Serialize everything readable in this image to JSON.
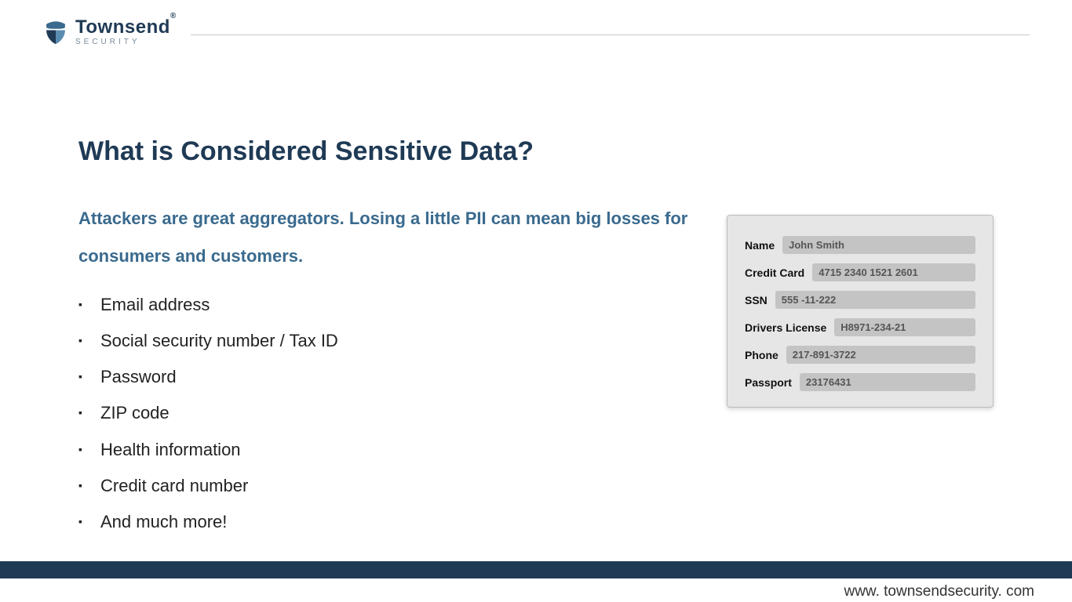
{
  "logo": {
    "main": "Townsend",
    "sub": "SECURITY"
  },
  "title": "What is Considered Sensitive Data?",
  "subtitle": "Attackers are great aggregators.  Losing a little PII can mean big losses for consumers and customers.",
  "bullets": [
    "Email address",
    "Social security number / Tax ID",
    "Password",
    "ZIP code",
    "Health information",
    "Credit card number",
    "And much more!"
  ],
  "card": {
    "rows": [
      {
        "label": "Name",
        "value": "John Smith"
      },
      {
        "label": "Credit Card",
        "value": "4715 2340 1521 2601"
      },
      {
        "label": "SSN",
        "value": "555 -11-222"
      },
      {
        "label": "Drivers License",
        "value": "H8971-234-21"
      },
      {
        "label": "Phone",
        "value": "217-891-3722"
      },
      {
        "label": "Passport",
        "value": "23176431"
      }
    ]
  },
  "footer": {
    "url": "www. townsendsecurity. com"
  }
}
